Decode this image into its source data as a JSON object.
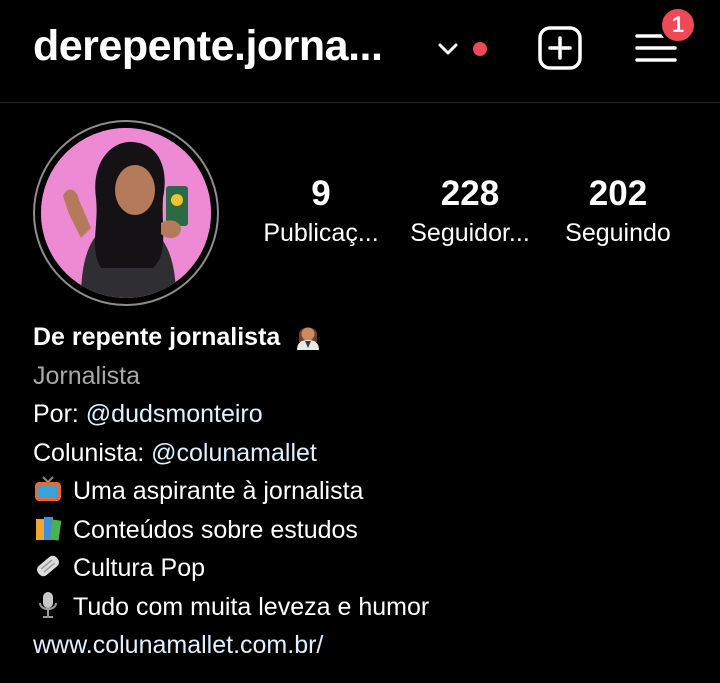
{
  "header": {
    "username": "derepente.jorna...",
    "notification_count": "1",
    "icons": [
      "chevron-down-icon",
      "new-post-icon",
      "menu-icon"
    ],
    "colors": {
      "badge": "#ed4956",
      "background": "#000000"
    }
  },
  "profile": {
    "stats": [
      {
        "value": "9",
        "label": "Publicaç..."
      },
      {
        "value": "228",
        "label": "Seguidor..."
      },
      {
        "value": "202",
        "label": "Seguindo"
      }
    ]
  },
  "bio": {
    "name": "De repente jornalista",
    "category": "Jornalista",
    "by_prefix": "Por: ",
    "by_handle": "@dudsmonteiro",
    "columnist_prefix": "Colunista: ",
    "columnist_handle": "@colunamallet",
    "lines": [
      {
        "icon": "tv-emoji-icon",
        "text": "Uma aspirante à jornalista"
      },
      {
        "icon": "books-emoji-icon",
        "text": "Conteúdos sobre estudos"
      },
      {
        "icon": "newspaper-emoji-icon",
        "text": "Cultura Pop"
      },
      {
        "icon": "microphone-emoji-icon",
        "text": "Tudo com muita leveza e humor"
      }
    ],
    "website": "www.colunamallet.com.br/"
  }
}
